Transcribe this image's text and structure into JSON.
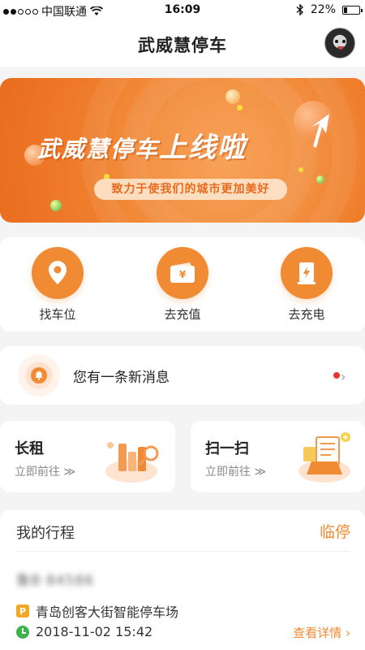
{
  "status_bar": {
    "carrier": "中国联通",
    "time": "16:09",
    "battery": "22%",
    "battery_level": 0.22
  },
  "header": {
    "title": "武威慧停车"
  },
  "banner": {
    "title_main": "武威慧停车",
    "title_tail": "上线啦",
    "subtitle": "致力于使我们的城市更加美好"
  },
  "quick_actions": [
    {
      "label": "找车位",
      "icon": "location-pin-icon"
    },
    {
      "label": "去充值",
      "icon": "wallet-yen-icon"
    },
    {
      "label": "去充电",
      "icon": "charging-station-icon"
    }
  ],
  "message": {
    "text": "您有一条新消息"
  },
  "features": [
    {
      "title": "长租",
      "subtitle": "立即前往 ≫"
    },
    {
      "title": "扫一扫",
      "subtitle": "立即前往 ≫"
    }
  ],
  "trips": {
    "title": "我的行程",
    "action": "临停",
    "plate": "鲁B·84586",
    "parking_lot": "青岛创客大街智能停车场",
    "time": "2018-11-02 15:42",
    "details_label": "查看详情 ›"
  },
  "colors": {
    "accent": "#f08a33",
    "banner_orange": "#ef7e2c",
    "clock_green": "#3bb34a",
    "badge_red": "#e33333"
  }
}
